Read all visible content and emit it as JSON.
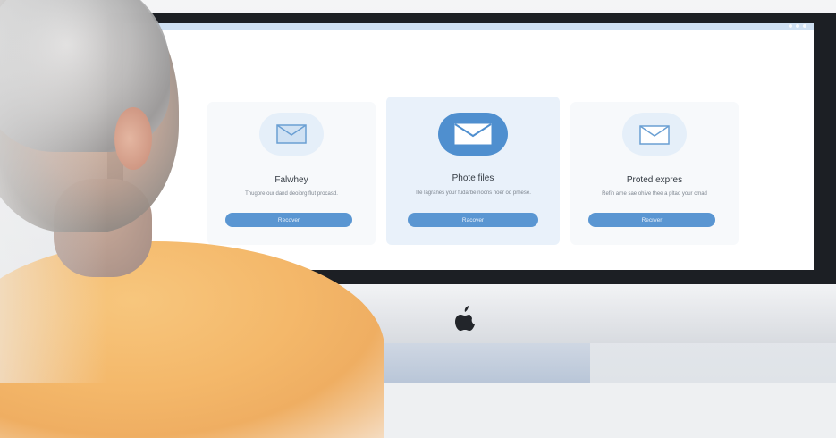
{
  "screen": {
    "cards": [
      {
        "title": "Falwhey",
        "description": "Thugore our dand deoibrg flut procasd.",
        "button_label": "Recover",
        "icon": "mail-icon"
      },
      {
        "title": "Phote files",
        "description": "Tle lagranes your fudarbe nocns noer od prhese.",
        "button_label": "Racover",
        "icon": "mail-icon"
      },
      {
        "title": "Proted expres",
        "description": "Refin arne sae ohive thee a pltao your cmad",
        "button_label": "Recrver",
        "icon": "mail-icon"
      }
    ]
  },
  "colors": {
    "accent": "#5a96d2",
    "featured_icon_bg": "#4f8fcf",
    "shirt": "#f4b86a"
  }
}
